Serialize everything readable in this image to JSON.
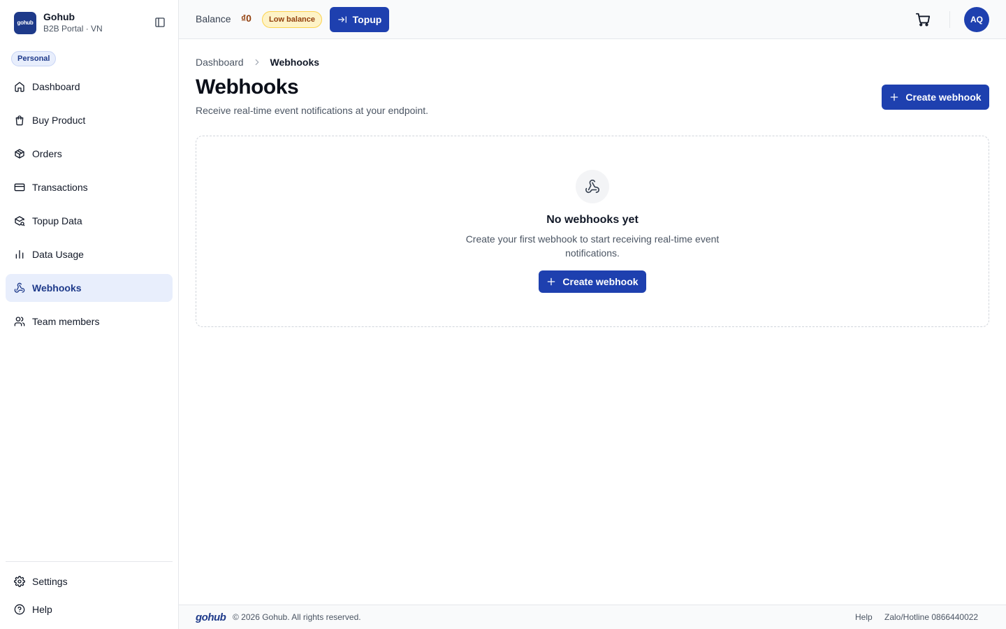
{
  "brand": {
    "logo_text": "gohub",
    "name": "Gohub",
    "subtitle": "B2B Portal · VN"
  },
  "sidebar": {
    "workspace_badge": "Personal",
    "items": [
      {
        "label": "Dashboard",
        "icon": "home-icon",
        "active": false
      },
      {
        "label": "Buy Product",
        "icon": "shopping-bag-icon",
        "active": false
      },
      {
        "label": "Orders",
        "icon": "package-icon",
        "active": false
      },
      {
        "label": "Transactions",
        "icon": "credit-card-icon",
        "active": false
      },
      {
        "label": "Topup Data",
        "icon": "package-search-icon",
        "active": false
      },
      {
        "label": "Data Usage",
        "icon": "bar-chart-icon",
        "active": false
      },
      {
        "label": "Webhooks",
        "icon": "webhook-icon",
        "active": true
      },
      {
        "label": "Team members",
        "icon": "users-icon",
        "active": false
      }
    ],
    "bottom_items": [
      {
        "label": "Settings",
        "icon": "gear-icon"
      },
      {
        "label": "Help",
        "icon": "help-circle-icon"
      }
    ]
  },
  "header": {
    "balance_label": "Balance",
    "balance_value": "₫0",
    "low_balance_badge": "Low balance",
    "topup_label": "Topup",
    "avatar_initials": "AQ"
  },
  "breadcrumb": {
    "parent": "Dashboard",
    "current": "Webhooks"
  },
  "page": {
    "title": "Webhooks",
    "subtitle": "Receive real-time event notifications at your endpoint.",
    "create_button": "Create webhook"
  },
  "empty_state": {
    "title": "No webhooks yet",
    "description": "Create your first webhook to start receiving real-time event notifications.",
    "create_button": "Create webhook"
  },
  "footer": {
    "logo_text": "gohub",
    "copyright": "© 2026 Gohub. All rights reserved.",
    "help_link": "Help",
    "hotline": "Zalo/Hotline 0866440022"
  },
  "colors": {
    "primary": "#1e40af",
    "brand": "#1e3a8a",
    "active_bg": "#e8eefc",
    "warning_bg": "#fef3c7",
    "warning_text": "#92400e"
  }
}
